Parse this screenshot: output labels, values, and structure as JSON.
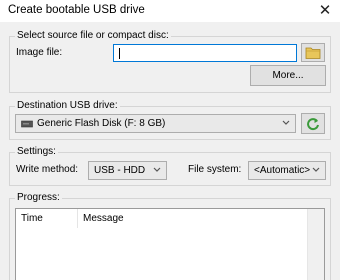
{
  "window": {
    "title": "Create bootable USB drive"
  },
  "source_group": {
    "legend": "Select source file or compact disc:",
    "image_label": "Image file:",
    "image_value": "",
    "more_button": "More..."
  },
  "destination_group": {
    "legend": "Destination USB drive:",
    "drive": "Generic Flash Disk (F: 8 GB)"
  },
  "settings_group": {
    "legend": "Settings:",
    "write_method_label": "Write method:",
    "write_method_value": "USB - HDD",
    "file_system_label": "File system:",
    "file_system_value": "<Automatic>"
  },
  "progress_group": {
    "legend": "Progress:",
    "columns": [
      "Time",
      "Message"
    ]
  },
  "icons": {
    "browse": "folder-icon",
    "refresh": "refresh-icon",
    "drive": "usb-drive-icon",
    "close": "close-icon",
    "accent": "#0078d7",
    "folder_color": "#e8c65a",
    "refresh_color": "#3a9a3a"
  }
}
